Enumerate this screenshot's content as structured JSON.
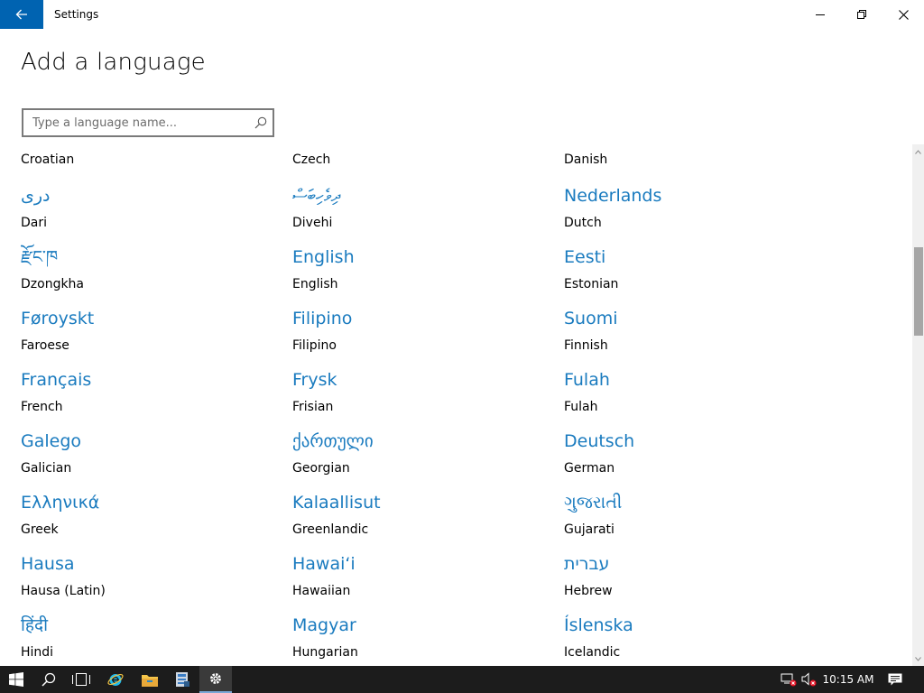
{
  "window": {
    "title": "Settings"
  },
  "page": {
    "title": "Add a language"
  },
  "search": {
    "placeholder": "Type a language name...",
    "value": ""
  },
  "languages": [
    {
      "native": "",
      "english": "Croatian"
    },
    {
      "native": "",
      "english": "Czech"
    },
    {
      "native": "",
      "english": "Danish"
    },
    {
      "native": "دری",
      "english": "Dari"
    },
    {
      "native": "ދިވެހިބަސް",
      "english": "Divehi"
    },
    {
      "native": "Nederlands",
      "english": "Dutch"
    },
    {
      "native": "རྫོང་ཁ",
      "english": "Dzongkha"
    },
    {
      "native": "English",
      "english": "English"
    },
    {
      "native": "Eesti",
      "english": "Estonian"
    },
    {
      "native": "Føroyskt",
      "english": "Faroese"
    },
    {
      "native": "Filipino",
      "english": "Filipino"
    },
    {
      "native": "Suomi",
      "english": "Finnish"
    },
    {
      "native": "Français",
      "english": "French"
    },
    {
      "native": "Frysk",
      "english": "Frisian"
    },
    {
      "native": "Fulah",
      "english": "Fulah"
    },
    {
      "native": "Galego",
      "english": "Galician"
    },
    {
      "native": "ქართული",
      "english": "Georgian"
    },
    {
      "native": "Deutsch",
      "english": "German"
    },
    {
      "native": "Ελληνικά",
      "english": "Greek"
    },
    {
      "native": "Kalaallisut",
      "english": "Greenlandic"
    },
    {
      "native": "ગુજરાતી",
      "english": "Gujarati"
    },
    {
      "native": "Hausa",
      "english": "Hausa (Latin)"
    },
    {
      "native": "Hawaiʻi",
      "english": "Hawaiian"
    },
    {
      "native": "עברית",
      "english": "Hebrew"
    },
    {
      "native": "हिंदी",
      "english": "Hindi"
    },
    {
      "native": "Magyar",
      "english": "Hungarian"
    },
    {
      "native": "Íslenska",
      "english": "Icelandic"
    }
  ],
  "taskbar": {
    "clock": "10:15 AM",
    "icons": [
      "windows-start-icon",
      "search-icon",
      "task-view-icon",
      "internet-explorer-icon",
      "file-explorer-icon",
      "server-manager-icon",
      "settings-icon"
    ]
  },
  "colors": {
    "accent": "#0063b1",
    "link": "#1a7bbf",
    "taskbar": "#1c1c1c"
  }
}
